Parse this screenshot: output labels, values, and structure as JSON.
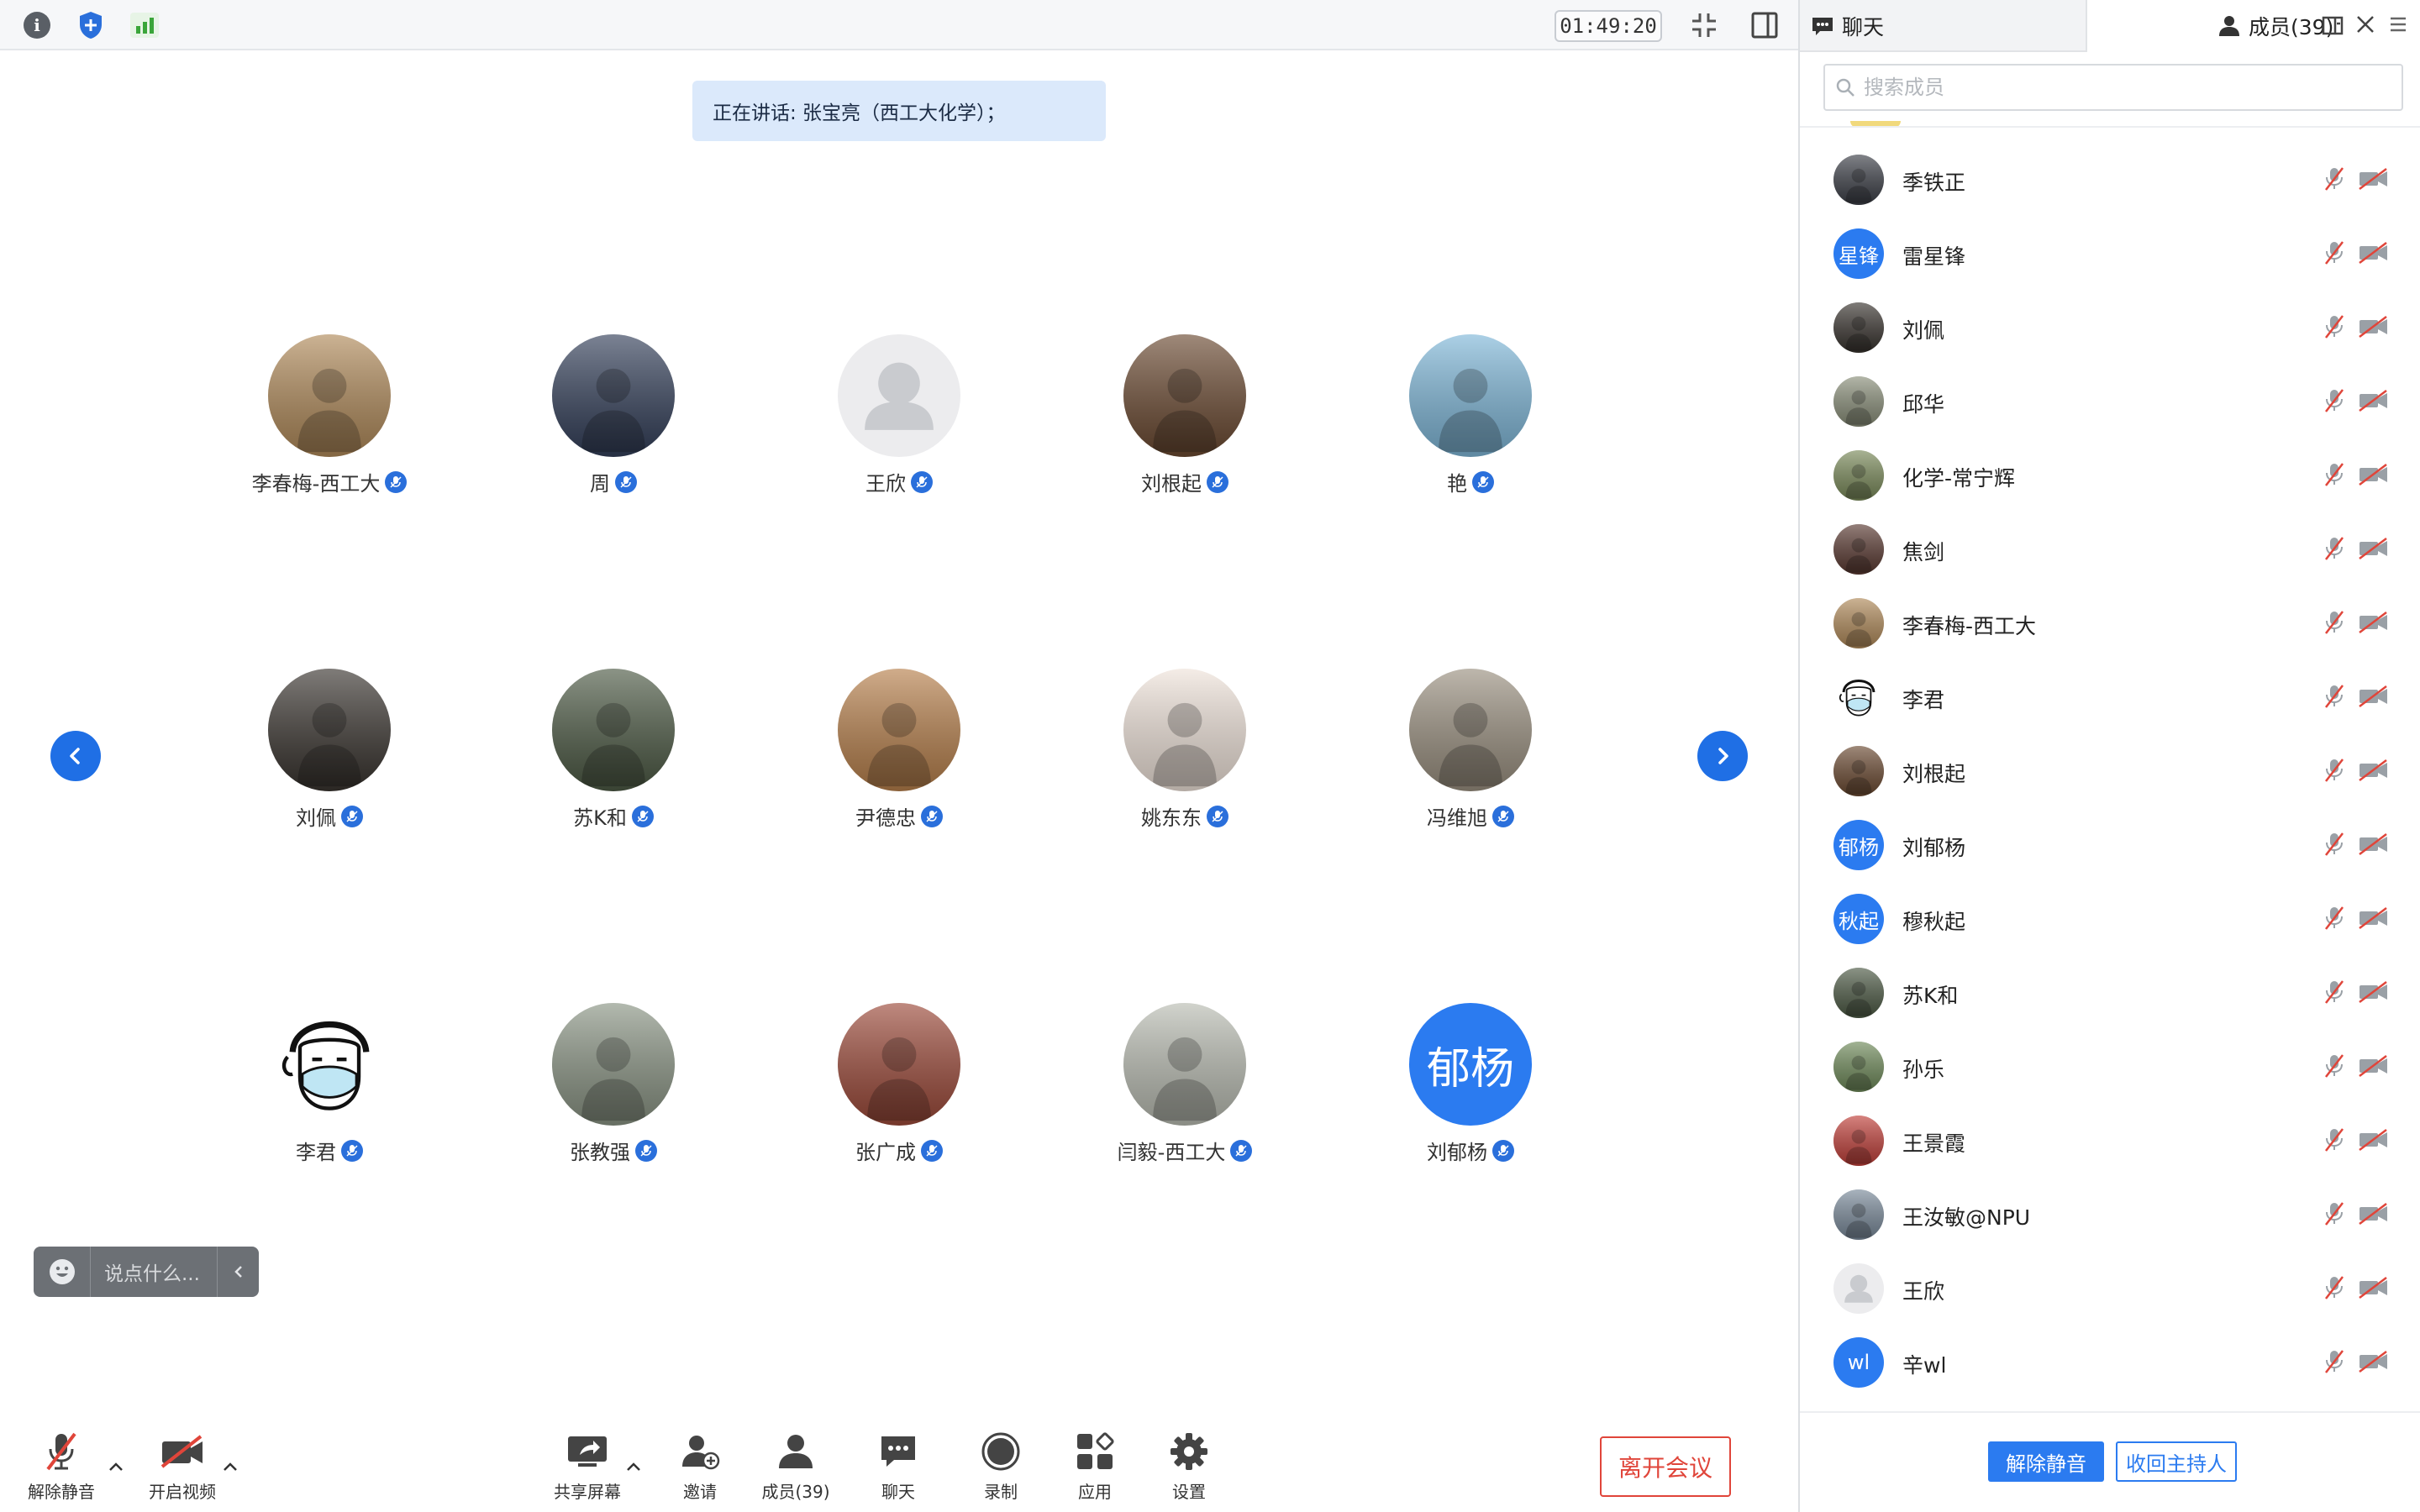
{
  "topbar": {
    "icons": [
      "info-icon",
      "shield-icon",
      "signal-bars-icon"
    ],
    "timer": "01:49:20",
    "right_icons": [
      "collapse-icon",
      "sidebar-toggle-icon"
    ]
  },
  "speaking": {
    "text": "正在讲话: 张宝亮（西工大化学）；"
  },
  "gallery": {
    "tiles": [
      {
        "name": "李春梅-西工大",
        "avatar": "photo",
        "color": "#b08a5a"
      },
      {
        "name": "周",
        "avatar": "photo",
        "color": "#34405a"
      },
      {
        "name": "王欣",
        "avatar": "default",
        "color": "#e9eaec"
      },
      {
        "name": "刘根起",
        "avatar": "photo",
        "color": "#6b4a32"
      },
      {
        "name": "艳",
        "avatar": "photo",
        "color": "#7fb7d8"
      },
      {
        "name": "刘佩",
        "avatar": "photo",
        "color": "#3a3530"
      },
      {
        "name": "苏K和",
        "avatar": "photo",
        "color": "#4d5a45"
      },
      {
        "name": "尹德忠",
        "avatar": "photo",
        "color": "#b7804c"
      },
      {
        "name": "姚东东",
        "avatar": "photo",
        "color": "#efe3da"
      },
      {
        "name": "冯维旭",
        "avatar": "photo",
        "color": "#9a9080"
      },
      {
        "name": "李君",
        "avatar": "cartoon",
        "color": "#ffffff"
      },
      {
        "name": "张教强",
        "avatar": "photo",
        "color": "#8a9484"
      },
      {
        "name": "张广成",
        "avatar": "photo",
        "color": "#9c4a3a"
      },
      {
        "name": "闫毅-西工大",
        "avatar": "photo",
        "color": "#b9bcb2"
      },
      {
        "name": "刘郁杨",
        "avatar": "text",
        "initials": "郁杨",
        "color": "#2b7bf0"
      }
    ]
  },
  "chat_quick": {
    "placeholder": "说点什么..."
  },
  "toolbar": {
    "unmute": "解除静音",
    "video": "开启视频",
    "share": "共享屏幕",
    "invite": "邀请",
    "members": "成员(39)",
    "chat": "聊天",
    "record": "录制",
    "apps": "应用",
    "settings": "设置",
    "leave": "离开会议"
  },
  "side_panel": {
    "tab_chat": "聊天",
    "tab_members": "成员(39)",
    "search_placeholder": "搜索成员",
    "members": [
      {
        "name": "季铁正",
        "avatar": "photo",
        "color": "#3d4048"
      },
      {
        "name": "雷星锋",
        "avatar": "text",
        "initials": "星锋",
        "color": "#2b7bf0"
      },
      {
        "name": "刘佩",
        "avatar": "photo",
        "color": "#3a3530"
      },
      {
        "name": "邱华",
        "avatar": "photo",
        "color": "#8a8f7a"
      },
      {
        "name": "化学-常宁辉",
        "avatar": "photo",
        "color": "#7a8a5a"
      },
      {
        "name": "焦剑",
        "avatar": "photo",
        "color": "#5a3a32"
      },
      {
        "name": "李春梅-西工大",
        "avatar": "photo",
        "color": "#b08a5a"
      },
      {
        "name": "李君",
        "avatar": "cartoon",
        "color": "#ffffff"
      },
      {
        "name": "刘根起",
        "avatar": "photo",
        "color": "#6b4a32"
      },
      {
        "name": "刘郁杨",
        "avatar": "text",
        "initials": "郁杨",
        "color": "#2b7bf0"
      },
      {
        "name": "穆秋起",
        "avatar": "text",
        "initials": "秋起",
        "color": "#2b7bf0"
      },
      {
        "name": "苏K和",
        "avatar": "photo",
        "color": "#4d5a45"
      },
      {
        "name": "孙乐",
        "avatar": "photo",
        "color": "#6f8a5a"
      },
      {
        "name": "王景霞",
        "avatar": "photo",
        "color": "#c0403a"
      },
      {
        "name": "王汝敏@NPU",
        "avatar": "photo",
        "color": "#7a8a9a"
      },
      {
        "name": "王欣",
        "avatar": "default",
        "color": "#e9eaec"
      },
      {
        "name": "辛wl",
        "avatar": "text",
        "initials": "wl",
        "color": "#2b7bf0"
      }
    ],
    "unmute_all": "解除静音",
    "reclaim_host": "收回主持人"
  }
}
